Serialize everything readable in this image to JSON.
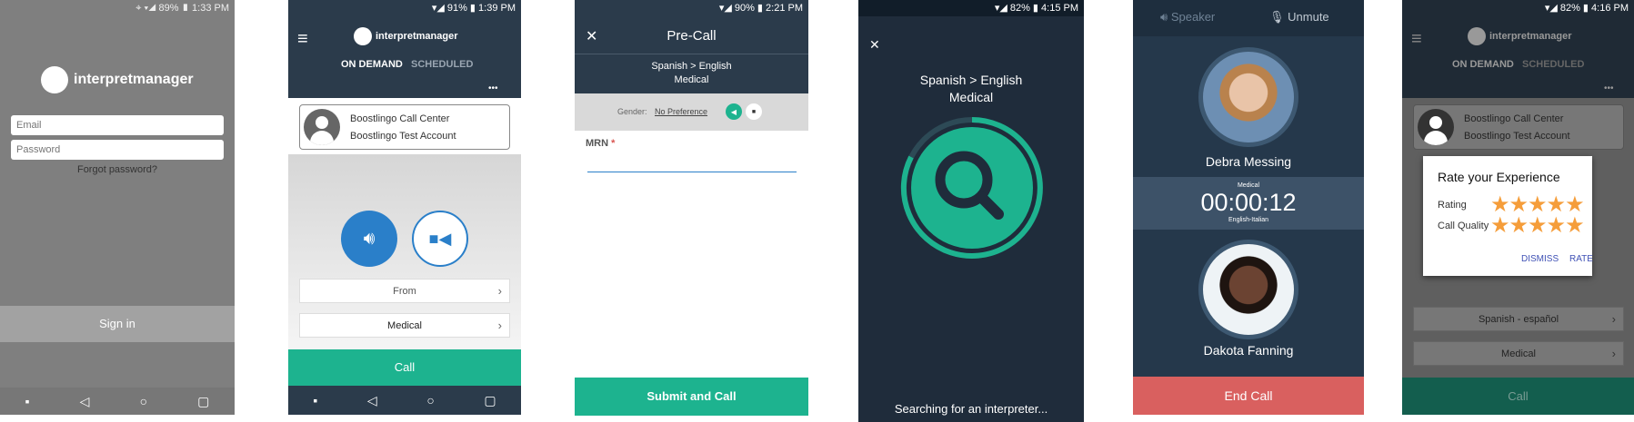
{
  "s1": {
    "status": "⌖ ▾◢ 89% ▮ 1:33 PM",
    "brand": "interpretmanager",
    "email_placeholder": "Email",
    "password_placeholder": "Password",
    "forgot": "Forgot password?",
    "signin": "Sign in"
  },
  "s2": {
    "status": "▾◢ 91% ▮ 1:39 PM",
    "brand": "interpretmanager",
    "tabs": [
      "ON DEMAND",
      "SCHEDULED"
    ],
    "more": "•••",
    "account_line1": "Boostlingo Call Center",
    "account_line2": "Boostlingo Test Account",
    "from": "From",
    "specialty": "Medical",
    "call": "Call"
  },
  "s3": {
    "status": "▾◢ 90% ▮ 2:21 PM",
    "title": "Pre-Call",
    "lang": "Spanish > English",
    "specialty": "Medical",
    "gender_label": "Gender:",
    "gender_value": "No Preference",
    "mrn_label": "MRN",
    "required": "*",
    "submit": "Submit and Call"
  },
  "s4": {
    "status": "▾◢ 82% ▮ 4:15 PM",
    "lang": "Spanish > English",
    "specialty": "Medical",
    "searching": "Searching for an interpreter..."
  },
  "s5": {
    "speaker": "Speaker",
    "unmute": "Unmute",
    "caller": "Debra Messing",
    "timer_top": "Medical",
    "timer": "00:00:12",
    "timer_bottom": "English-Italian",
    "interpreter": "Dakota Fanning",
    "end_call": "End Call"
  },
  "s6": {
    "status": "▾◢ 82% ▮ 4:16 PM",
    "brand": "interpretmanager",
    "tabs": [
      "ON DEMAND",
      "SCHEDULED"
    ],
    "more": "•••",
    "account_line1": "Boostlingo Call Center",
    "account_line2": "Boostlingo Test Account",
    "language": "Spanish - español",
    "specialty": "Medical",
    "call": "Call",
    "dialog_title": "Rate your Experience",
    "rating_label": "Rating",
    "quality_label": "Call Quality",
    "rating_value": 5,
    "quality_value": 5,
    "dismiss": "DISMISS",
    "rate": "RATE"
  },
  "colors": {
    "accent_green": "#1db38f",
    "header_dark": "#2b3b4b",
    "end_call_red": "#d9605f",
    "blue": "#2a7fc9",
    "star": "#f59d3a"
  }
}
